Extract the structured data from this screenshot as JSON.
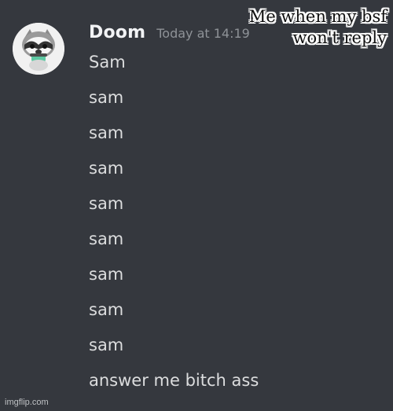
{
  "header": {
    "username": "Doom",
    "timestamp": "Today at 14:19"
  },
  "messages": [
    "Sam",
    "sam",
    "sam",
    "sam",
    "sam",
    "sam",
    "sam",
    "sam",
    "sam",
    "answer me bitch ass"
  ],
  "overlay": {
    "caption": "Me when my bsf won't reply"
  },
  "watermark": "imgflip.com",
  "colors": {
    "background": "#36393f",
    "username": "#f2f3f5",
    "message_text": "#dcddde",
    "timestamp": "#8e9297"
  },
  "icons": {
    "avatar": "raccoon-avatar-icon"
  }
}
